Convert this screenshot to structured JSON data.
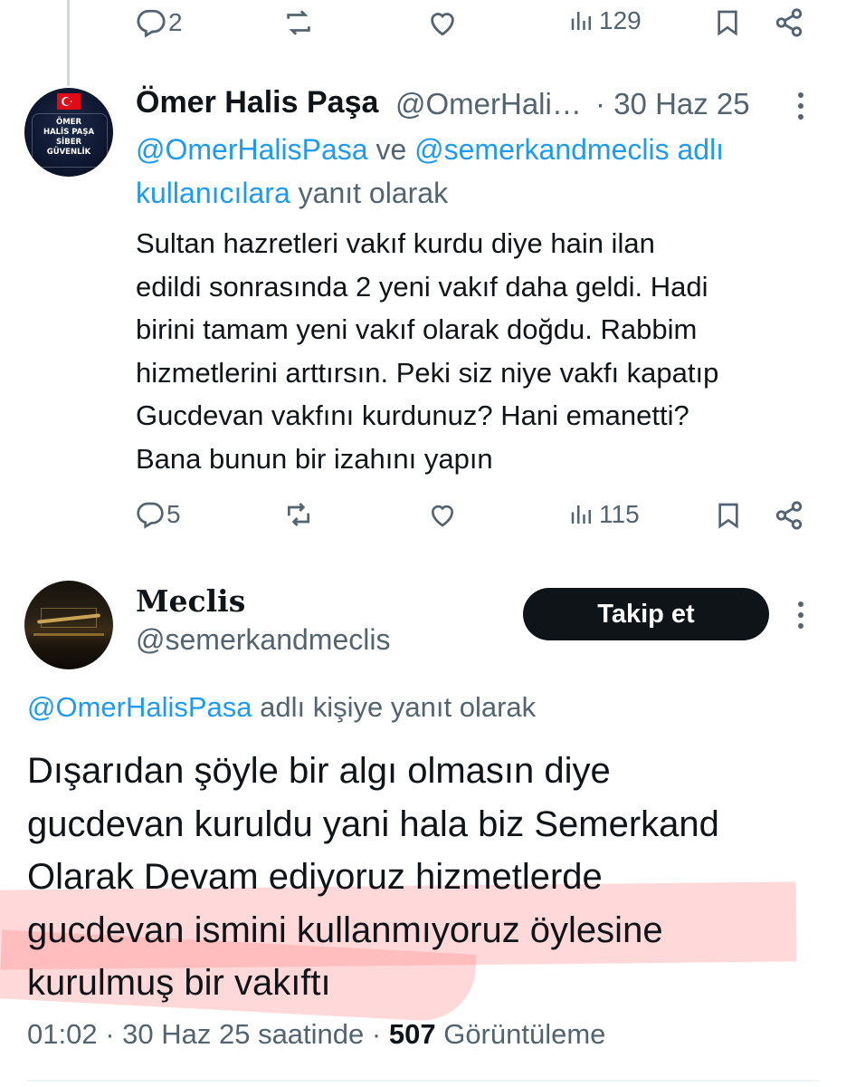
{
  "top_actions": {
    "replies": "2",
    "views": "129"
  },
  "tweet1": {
    "author_name": "Ömer Halis Paşa",
    "handle": "@OmerHali…",
    "date": "· 30 Haz 25",
    "avatar_lines": [
      "ÖMER",
      "HALİS PAŞA",
      "SİBER",
      "GÜVENLİK"
    ],
    "reply_mention_1": "@OmerHalisPasa",
    "reply_conj": "ve",
    "reply_mention_2": "@semerkandmeclis adlı",
    "reply_mention_3": "kullanıcılara",
    "reply_suffix": "yanıt olarak",
    "body": [
      "Sultan hazretleri vakıf kurdu diye hain ilan",
      "edildi sonrasında 2 yeni vakıf daha geldi. Hadi",
      "birini tamam yeni vakıf olarak doğdu. Rabbim",
      "hizmetlerini arttırsın. Peki siz niye vakfı kapatıp",
      "Gucdevan vakfını kurdunuz? Hani emanetti?",
      "Bana bunun bir izahını yapın"
    ],
    "replies": "5",
    "views": "115"
  },
  "tweet2": {
    "author_name": "Meclis",
    "handle": "@semerkandmeclis",
    "follow_label": "Takip et",
    "reply_mention": "@OmerHalisPasa",
    "reply_suffix": "adlı kişiye yanıt olarak",
    "body": [
      "Dışarıdan şöyle bir algı olmasın diye",
      "gucdevan kuruldu yani hala biz Semerkand",
      "Olarak Devam ediyoruz hizmetlerde",
      "gucdevan ismini kullanmıyoruz öylesine",
      "kurulmuş bir vakıftı"
    ],
    "time": "01:02",
    "date": "· 30 Haz 25 saatinde ·",
    "views_count": "507",
    "views_label": "Görüntüleme"
  },
  "colors": {
    "link": "#1d9bf0",
    "muted": "#536471",
    "text": "#0f1419",
    "highlight": "#ff7878"
  }
}
